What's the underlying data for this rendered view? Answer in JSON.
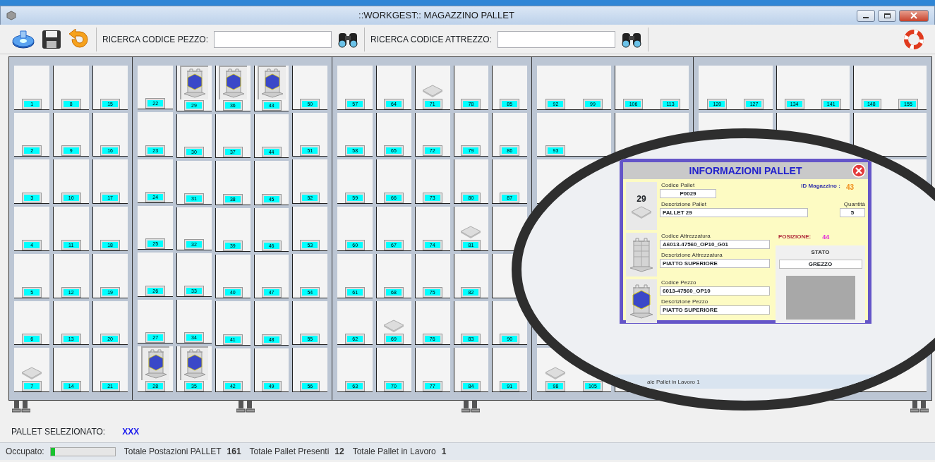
{
  "window": {
    "title": "::WORKGEST::  MAGAZZINO PALLET"
  },
  "toolbar": {
    "part_search": {
      "label": "RICERCA CODICE PEZZO:"
    },
    "tool_search": {
      "label": "RICERCA CODICE ATTREZZO:"
    }
  },
  "rack": {
    "bays": [
      {
        "cells": [
          {
            "columns": [
              [
                {
                  "number": "1"
                },
                {
                  "number": "2"
                },
                {
                  "number": "3"
                },
                {
                  "number": "4"
                },
                {
                  "number": "5"
                },
                {
                  "number": "6"
                },
                {
                  "number": "7",
                  "kind": "empty"
                }
              ]
            ]
          },
          {
            "columns": [
              [
                {
                  "number": "8"
                },
                {
                  "number": "9"
                },
                {
                  "number": "10"
                },
                {
                  "number": "11"
                },
                {
                  "number": "12"
                },
                {
                  "number": "13"
                },
                {
                  "number": "14"
                }
              ]
            ]
          },
          {
            "columns": [
              [
                {
                  "number": "15"
                },
                {
                  "number": "16"
                },
                {
                  "number": "17"
                },
                {
                  "number": "18"
                },
                {
                  "number": "19"
                },
                {
                  "number": "20"
                },
                {
                  "number": "21"
                }
              ]
            ]
          }
        ]
      },
      {
        "cells": [
          {
            "columns": [
              [
                {
                  "number": "22"
                },
                {
                  "number": "23"
                },
                {
                  "number": "24"
                },
                {
                  "number": "25"
                },
                {
                  "number": "26"
                },
                {
                  "number": "27"
                },
                {
                  "number": "28",
                  "kind": "loaded"
                }
              ]
            ]
          },
          {
            "columns": [
              [
                {
                  "number": "29",
                  "kind": "loaded"
                },
                {
                  "number": "30"
                },
                {
                  "number": "31"
                },
                {
                  "number": "32"
                },
                {
                  "number": "33"
                },
                {
                  "number": "34"
                },
                {
                  "number": "35",
                  "kind": "loaded"
                }
              ]
            ]
          },
          {
            "columns": [
              [
                {
                  "number": "36",
                  "kind": "loaded"
                },
                {
                  "number": "37"
                },
                {
                  "number": "38"
                },
                {
                  "number": "39"
                },
                {
                  "number": "40"
                },
                {
                  "number": "41"
                },
                {
                  "number": "42"
                }
              ]
            ]
          },
          {
            "columns": [
              [
                {
                  "number": "43",
                  "kind": "loaded"
                },
                {
                  "number": "44"
                },
                {
                  "number": "45"
                },
                {
                  "number": "46"
                },
                {
                  "number": "47"
                },
                {
                  "number": "48"
                },
                {
                  "number": "49"
                }
              ]
            ]
          },
          {
            "columns": [
              [
                {
                  "number": "50"
                },
                {
                  "number": "51"
                },
                {
                  "number": "52"
                },
                {
                  "number": "53"
                },
                {
                  "number": "54"
                },
                {
                  "number": "55"
                },
                {
                  "number": "56"
                }
              ]
            ]
          }
        ]
      },
      {
        "cells": [
          {
            "columns": [
              [
                {
                  "number": "57"
                },
                {
                  "number": "58"
                },
                {
                  "number": "59"
                },
                {
                  "number": "60"
                },
                {
                  "number": "61"
                },
                {
                  "number": "62"
                },
                {
                  "number": "63"
                }
              ]
            ]
          },
          {
            "columns": [
              [
                {
                  "number": "64"
                },
                {
                  "number": "65"
                },
                {
                  "number": "66"
                },
                {
                  "number": "67"
                },
                {
                  "number": "68"
                },
                {
                  "number": "69",
                  "kind": "empty"
                },
                {
                  "number": "70"
                }
              ]
            ]
          },
          {
            "columns": [
              [
                {
                  "number": "71",
                  "kind": "empty"
                },
                {
                  "number": "72"
                },
                {
                  "number": "73"
                },
                {
                  "number": "74"
                },
                {
                  "number": "75"
                },
                {
                  "number": "76"
                },
                {
                  "number": "77"
                }
              ]
            ]
          },
          {
            "columns": [
              [
                {
                  "number": "78"
                },
                {
                  "number": "79"
                },
                {
                  "number": "80"
                },
                {
                  "number": "81",
                  "kind": "empty"
                },
                {
                  "number": "82"
                },
                {
                  "number": "83"
                },
                {
                  "number": "84"
                }
              ]
            ]
          },
          {
            "columns": [
              [
                {
                  "number": "85"
                },
                {
                  "number": "86"
                },
                {
                  "number": "87"
                },
                null,
                null,
                {
                  "number": "90"
                },
                {
                  "number": "91"
                }
              ]
            ]
          }
        ]
      },
      {
        "cells": [
          {
            "columns": [
              [
                {
                  "number": "92"
                },
                {
                  "number": "93"
                },
                null,
                null,
                null,
                null,
                {
                  "number": "98",
                  "kind": "empty"
                }
              ],
              [
                {
                  "number": "99"
                },
                null,
                null,
                null,
                null,
                null,
                {
                  "number": "105"
                }
              ]
            ]
          },
          {
            "columns": [
              [
                {
                  "number": "106"
                },
                null,
                null,
                null,
                null,
                null,
                null
              ],
              [
                {
                  "number": "113"
                },
                null,
                null,
                null,
                null,
                null,
                null
              ]
            ]
          }
        ]
      },
      {
        "cells": [
          {
            "columns": [
              [
                {
                  "number": "120"
                },
                null,
                null,
                null,
                null,
                null,
                null
              ],
              [
                {
                  "number": "127"
                },
                null,
                null,
                null,
                null,
                null,
                null
              ]
            ]
          },
          {
            "columns": [
              [
                {
                  "number": "134"
                },
                null,
                null,
                null,
                null,
                null,
                null
              ],
              [
                {
                  "number": "141"
                },
                null,
                null,
                null,
                null,
                null,
                null
              ]
            ]
          },
          {
            "columns": [
              [
                {
                  "number": "148"
                },
                null,
                null,
                null,
                null,
                null,
                null
              ],
              [
                {
                  "number": "155"
                },
                null,
                null,
                null,
                null,
                null,
                null
              ]
            ]
          }
        ]
      }
    ]
  },
  "magnifier": {
    "fragment": "ale Pallet in Lavoro  1",
    "popup": {
      "title": "INFORMAZIONI PALLET",
      "pallet_number": "29",
      "pallet_code": {
        "label": "Codice Pallet",
        "value": "P0029"
      },
      "pallet_description": {
        "label": "Descrizione Pallet",
        "value": "PALLET  29"
      },
      "warehouse_id": {
        "label": "ID Magazzino :",
        "value": "43"
      },
      "quantity": {
        "label": "Quantità",
        "value": "5"
      },
      "tooling_code": {
        "label": "Codice Attrezzatura",
        "value": "A6013-47560_OP10_G01"
      },
      "tooling_description": {
        "label": "Descrizione Attrezzatura",
        "value": "PIATTO SUPERIORE"
      },
      "position": {
        "label": "POSIZIONE:",
        "value": "44"
      },
      "state": {
        "label": "STATO",
        "value": "GREZZO"
      },
      "part_code": {
        "label": "Codice Pezzo",
        "value": "6013-47560_OP10"
      },
      "part_description": {
        "label": "Descrizione Pezzo",
        "value": "PIATTO SUPERIORE"
      }
    }
  },
  "selected_pallet": {
    "label": "PALLET SELEZIONATO:",
    "value": "XXX"
  },
  "status_bar": {
    "occupied_label": "Occupato:",
    "level": 0.07,
    "totals": [
      {
        "label": "Totale Postazioni PALLET",
        "value": "161"
      },
      {
        "label": "Totale Pallet Presenti",
        "value": "12"
      },
      {
        "label": "Totale Pallet in Lavoro",
        "value": "1"
      }
    ]
  }
}
